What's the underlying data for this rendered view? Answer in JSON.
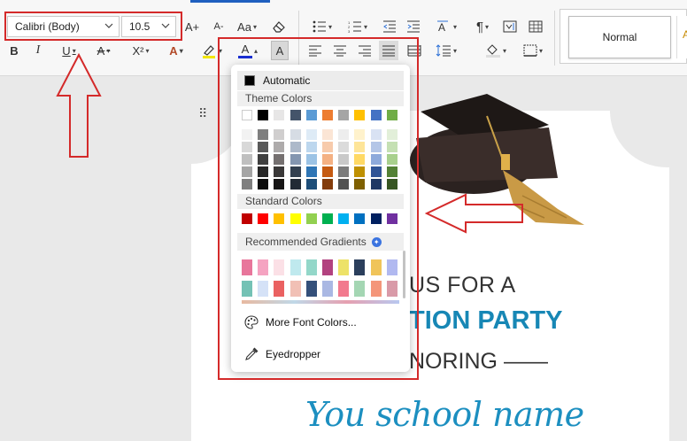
{
  "ribbon": {
    "font_name": "Calibri (Body)",
    "font_size": "10.5",
    "grow_font_icon": "A+",
    "shrink_font_icon": "A-",
    "change_case_label": "Aa",
    "bold": "B",
    "italic": "I",
    "underline": "U",
    "strikethrough": "A",
    "superscript": "X²",
    "text_effect": "A",
    "font_color_letter": "A",
    "char_shading_letter": "A",
    "style_normal": "Normal",
    "style_next": "A"
  },
  "document": {
    "line1": "US FOR A",
    "line2": "TION PARTY",
    "line3": "NORING ——",
    "line4": "You school name"
  },
  "color_popup": {
    "automatic_label": "Automatic",
    "theme_colors_label": "Theme Colors",
    "standard_colors_label": "Standard Colors",
    "recommended_gradients_label": "Recommended Gradients",
    "more_colors_label": "More Font Colors...",
    "eyedropper_label": "Eyedropper",
    "theme_top": [
      "#ffffff",
      "#000000",
      "#e7e6e6",
      "#44546a",
      "#5b9bd5",
      "#ed7d31",
      "#a5a5a5",
      "#ffc000",
      "#4472c4",
      "#70ad47"
    ],
    "theme_shades": [
      [
        "#f2f2f2",
        "#7f7f7f",
        "#d0cece",
        "#d6dce4",
        "#deebf6",
        "#fbe5d5",
        "#ededed",
        "#fff2cc",
        "#d9e2f3",
        "#e2efd9"
      ],
      [
        "#d8d8d8",
        "#595959",
        "#aeabab",
        "#adb9ca",
        "#bdd7ee",
        "#f7cbac",
        "#dbdbdb",
        "#fee599",
        "#b4c6e7",
        "#c5e0b3"
      ],
      [
        "#bfbfbf",
        "#3f3f3f",
        "#757070",
        "#8496b0",
        "#9cc3e5",
        "#f4b183",
        "#c9c9c9",
        "#ffd965",
        "#8eaadb",
        "#a8d08d"
      ],
      [
        "#a5a5a5",
        "#262626",
        "#3a3838",
        "#323f4f",
        "#2e75b5",
        "#c55a11",
        "#7b7b7b",
        "#bf9000",
        "#2f5496",
        "#538135"
      ],
      [
        "#7f7f7f",
        "#0c0c0c",
        "#171616",
        "#222a35",
        "#1e4e79",
        "#833c0b",
        "#525252",
        "#7f6000",
        "#1f3864",
        "#375623"
      ]
    ],
    "standard": [
      "#c00000",
      "#ff0000",
      "#ffc000",
      "#ffff00",
      "#92d050",
      "#00b050",
      "#00b0f0",
      "#0070c0",
      "#002060",
      "#7030a0"
    ],
    "gradients_row1": [
      "#e8769b",
      "#f5a3c1",
      "#fbe0e6",
      "#bfe9ee",
      "#93d7c9",
      "#b2427f",
      "#ede268",
      "#2b3f5c",
      "#f0c45a",
      "#b1b9f0"
    ],
    "gradients_row2": [
      "#74c2b5",
      "#d5e2f7",
      "#ea6161",
      "#f1c0b5",
      "#34507a",
      "#aab8e3",
      "#f27a8e",
      "#a4d6b3",
      "#f4967a",
      "#d99aa8"
    ]
  },
  "annotation_color": "#d42a2a"
}
